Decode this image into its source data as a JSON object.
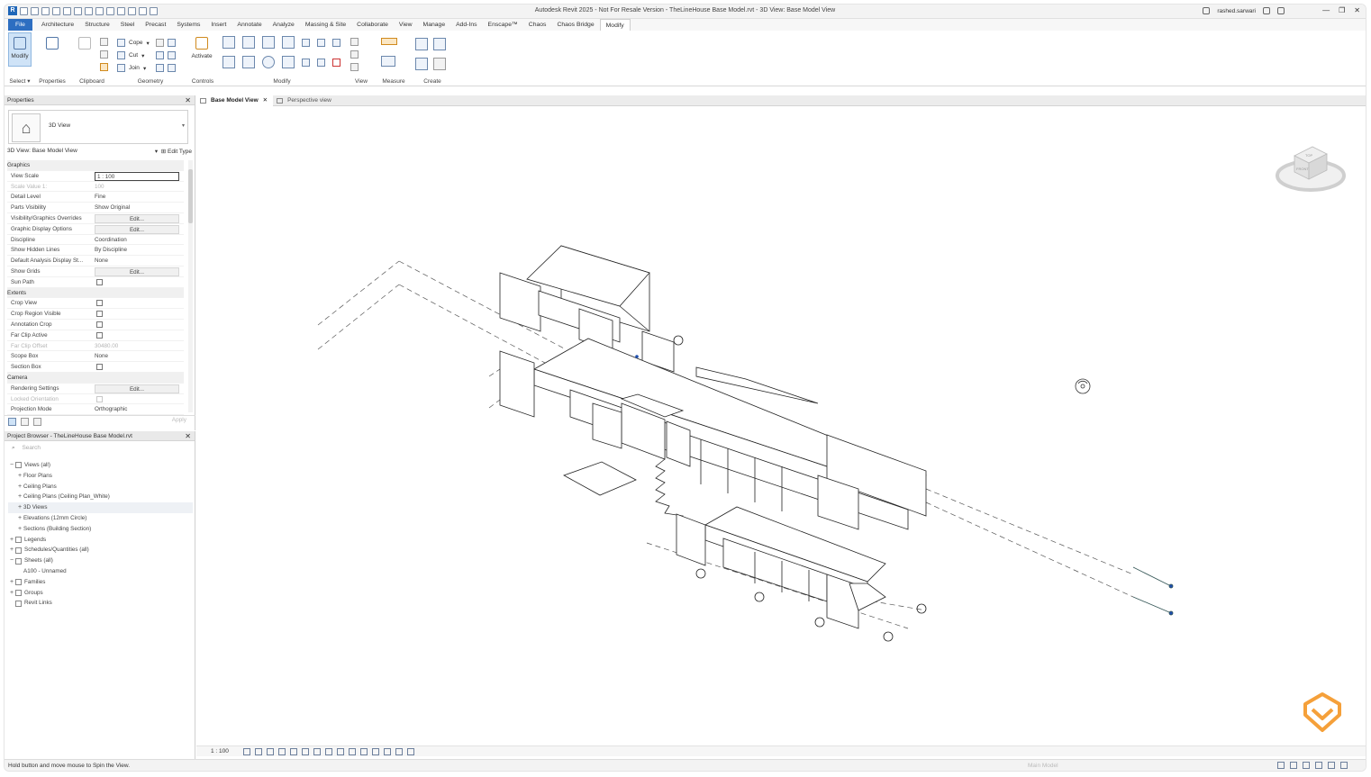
{
  "app": {
    "title": "Autodesk Revit 2025 - Not For Resale Version - TheLineHouse Base Model.rvt - 3D View: Base Model View",
    "user": "rashed.sarwari"
  },
  "menu": {
    "tabs": [
      "File",
      "Architecture",
      "Structure",
      "Steel",
      "Precast",
      "Systems",
      "Insert",
      "Annotate",
      "Analyze",
      "Massing & Site",
      "Collaborate",
      "View",
      "Manage",
      "Add-Ins",
      "Enscape™",
      "Chaos",
      "Chaos Bridge",
      "Modify"
    ],
    "active": "Modify"
  },
  "ribbon": {
    "modify_label": "Modify",
    "select_label": "Select ▾",
    "properties_label": "Properties",
    "clipboard_label": "Clipboard",
    "paste_label": "Paste",
    "geometry_label": "Geometry",
    "cope_label": "Cope",
    "cut_label": "Cut",
    "join_label": "Join",
    "controls_label": "Controls",
    "activate_label": "Activate",
    "modify_group_label": "Modify",
    "view_label": "View",
    "measure_label": "Measure",
    "create_label": "Create"
  },
  "properties": {
    "header": "Properties",
    "type_name": "3D View",
    "instance": "3D View: Base Model View",
    "edit_type": "Edit Type",
    "apply": "Apply",
    "rows": [
      {
        "kind": "cat",
        "name": "Graphics"
      },
      {
        "kind": "input",
        "name": "View Scale",
        "value": "1 : 100"
      },
      {
        "kind": "dim",
        "name": "Scale Value    1:",
        "value": "100"
      },
      {
        "kind": "text",
        "name": "Detail Level",
        "value": "Fine"
      },
      {
        "kind": "text",
        "name": "Parts Visibility",
        "value": "Show Original"
      },
      {
        "kind": "button",
        "name": "Visibility/Graphics Overrides",
        "value": "Edit..."
      },
      {
        "kind": "button",
        "name": "Graphic Display Options",
        "value": "Edit..."
      },
      {
        "kind": "text",
        "name": "Discipline",
        "value": "Coordination"
      },
      {
        "kind": "text",
        "name": "Show Hidden Lines",
        "value": "By Discipline"
      },
      {
        "kind": "text",
        "name": "Default Analysis Display St...",
        "value": "None"
      },
      {
        "kind": "button",
        "name": "Show Grids",
        "value": "Edit..."
      },
      {
        "kind": "check",
        "name": "Sun Path"
      },
      {
        "kind": "cat",
        "name": "Extents"
      },
      {
        "kind": "check",
        "name": "Crop View"
      },
      {
        "kind": "check",
        "name": "Crop Region Visible"
      },
      {
        "kind": "check",
        "name": "Annotation Crop"
      },
      {
        "kind": "check",
        "name": "Far Clip Active"
      },
      {
        "kind": "dim",
        "name": "Far Clip Offset",
        "value": "30480.00"
      },
      {
        "kind": "text",
        "name": "Scope Box",
        "value": "None"
      },
      {
        "kind": "check",
        "name": "Section Box"
      },
      {
        "kind": "cat",
        "name": "Camera"
      },
      {
        "kind": "button",
        "name": "Rendering Settings",
        "value": "Edit..."
      },
      {
        "kind": "dimcheck",
        "name": "Locked Orientation"
      },
      {
        "kind": "text",
        "name": "Projection Mode",
        "value": "Orthographic"
      }
    ]
  },
  "browser": {
    "header": "Project Browser - TheLineHouse Base Model.rvt",
    "search_placeholder": "Search",
    "nodes": [
      {
        "level": 0,
        "exp": "−",
        "label": "Views (all)"
      },
      {
        "level": 1,
        "exp": "+",
        "label": "Floor Plans"
      },
      {
        "level": 1,
        "exp": "+",
        "label": "Ceiling Plans"
      },
      {
        "level": 1,
        "exp": "+",
        "label": "Ceiling Plans (Ceiling Plan_White)"
      },
      {
        "level": 1,
        "exp": "+",
        "label": "3D Views",
        "sel": true
      },
      {
        "level": 1,
        "exp": "+",
        "label": "Elevations (12mm Circle)"
      },
      {
        "level": 1,
        "exp": "+",
        "label": "Sections (Building Section)"
      },
      {
        "level": 0,
        "exp": "+",
        "label": "Legends"
      },
      {
        "level": 0,
        "exp": "+",
        "label": "Schedules/Quantities (all)"
      },
      {
        "level": 0,
        "exp": "−",
        "label": "Sheets (all)"
      },
      {
        "level": 1,
        "exp": "",
        "label": "A100 - Unnamed"
      },
      {
        "level": 0,
        "exp": "+",
        "label": "Families"
      },
      {
        "level": 0,
        "exp": "+",
        "label": "Groups"
      },
      {
        "level": 0,
        "exp": "",
        "label": "Revit Links"
      }
    ]
  },
  "view_tabs": [
    {
      "label": "Base Model View",
      "active": true
    },
    {
      "label": "Perspective view",
      "active": false
    }
  ],
  "viewbar": {
    "scale": "1 : 100"
  },
  "status": {
    "message": "Hold button and move mouse to Spin the View.",
    "model": "Main Model"
  },
  "viewcube": {
    "top": "TOP",
    "front": "FRONT"
  },
  "colors": {
    "accent": "#2d6ec1",
    "logo_orange": "#f5a03a"
  }
}
